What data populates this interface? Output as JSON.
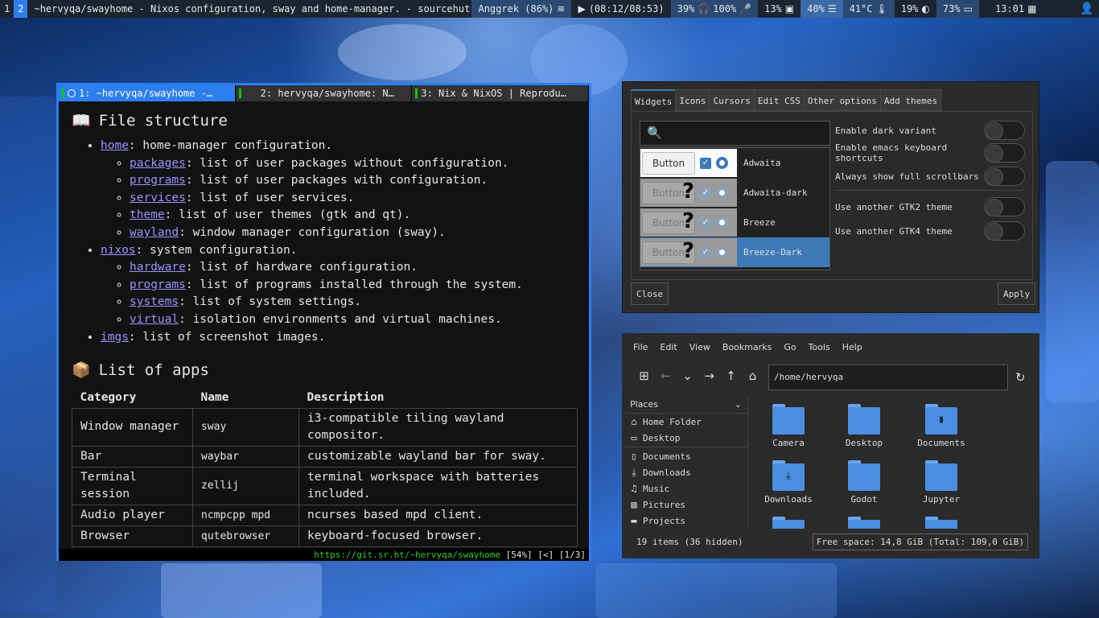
{
  "topbar": {
    "workspaces": [
      "1",
      "2"
    ],
    "window_title": "~hervyqa/swayhome - Nixos configuration, sway and home-manager. - sourcehut",
    "wifi": "Anggrek (86%)",
    "music": "(08:12/08:53)",
    "volume": "39%",
    "headphone": "100%",
    "cpu": "13%",
    "memory": "40%",
    "temp": "41°C",
    "brightness": "19%",
    "battery": "73%",
    "clock": "13:01"
  },
  "browser": {
    "tabs": [
      {
        "label": "1: ~hervyqa/swayhome -…"
      },
      {
        "label": "2: hervyqa/swayhome: N…"
      },
      {
        "label": "3: Nix & NixOS | Reprodu…"
      }
    ],
    "section1_title": "File structure",
    "section1_emoji": "📖",
    "tree": [
      {
        "link": "home",
        "text": ": home-manager configuration.",
        "children": [
          {
            "link": "packages",
            "text": ": list of user packages without configuration."
          },
          {
            "link": "programs",
            "text": ": list of user packages with configuration."
          },
          {
            "link": "services",
            "text": ": list of user services."
          },
          {
            "link": "theme",
            "text": ": list of user themes (gtk and qt)."
          },
          {
            "link": "wayland",
            "text": ": window manager configuration (sway)."
          }
        ]
      },
      {
        "link": "nixos",
        "text": ": system configuration.",
        "children": [
          {
            "link": "hardware",
            "text": ": list of hardware configuration."
          },
          {
            "link": "programs",
            "text": ": list of programs installed through the system."
          },
          {
            "link": "systems",
            "text": ": list of system settings."
          },
          {
            "link": "virtual",
            "text": ": isolation environments and virtual machines."
          }
        ]
      },
      {
        "link": "imgs",
        "text": ": list of screenshot images.",
        "children": []
      }
    ],
    "section2_title": "List of apps",
    "section2_emoji": "📦",
    "table_headers": [
      "Category",
      "Name",
      "Description"
    ],
    "table_rows": [
      [
        "Window manager",
        "sway",
        "i3-compatible tiling wayland compositor."
      ],
      [
        "Bar",
        "waybar",
        "customizable wayland bar for sway."
      ],
      [
        "Terminal session",
        "zellij",
        "terminal workspace with batteries included."
      ],
      [
        "Audio player",
        "ncmpcpp mpd",
        "ncurses based mpd client."
      ],
      [
        "Browser",
        "qutebrowser",
        "keyboard-focused browser."
      ]
    ],
    "status_url": "https://git.sr.ht/~hervyqa/swayhome",
    "status_info": "[54%] [<] [1/3]"
  },
  "gtk": {
    "tabs": [
      "Widgets",
      "Icons",
      "Cursors",
      "Edit CSS",
      "Other options",
      "Add themes"
    ],
    "preview_button": "Button",
    "themes": [
      "Adwaita",
      "Adwaita-dark",
      "Breeze",
      "Breeze-Dark"
    ],
    "options": [
      "Enable dark variant",
      "Enable emacs keyboard shortcuts",
      "Always show full scrollbars",
      "Use another GTK2 theme",
      "Use another GTK4 theme"
    ],
    "close_label": "Close",
    "apply_label": "Apply"
  },
  "filemanager": {
    "menu": [
      "File",
      "Edit",
      "View",
      "Bookmarks",
      "Go",
      "Tools",
      "Help"
    ],
    "path": "/home/hervyqa",
    "places_label": "Places",
    "places": [
      {
        "icon": "home-icon",
        "label": "Home Folder"
      },
      {
        "icon": "desktop-icon",
        "label": "Desktop"
      },
      {
        "icon": "documents-icon",
        "label": "Documents"
      },
      {
        "icon": "downloads-icon",
        "label": "Downloads"
      },
      {
        "icon": "music-icon",
        "label": "Music"
      },
      {
        "icon": "pictures-icon",
        "label": "Pictures"
      },
      {
        "icon": "folder-icon",
        "label": "Projects"
      }
    ],
    "folders": [
      "Camera",
      "Desktop",
      "Documents",
      "Downloads",
      "Godot",
      "Jupyter"
    ],
    "status_items": "19 items (36 hidden)",
    "status_free": "Free space: 14,8 GiB (Total: 109,0 GiB)"
  }
}
